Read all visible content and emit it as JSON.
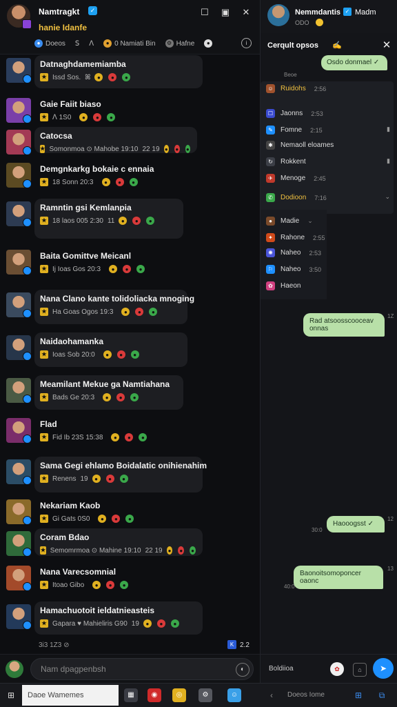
{
  "app": {
    "title": "Namtragkt",
    "subtitle": "hanie Idanfe",
    "verified_glyph": "✓"
  },
  "window_controls": [
    "☐",
    "▣",
    "✕"
  ],
  "tabs": [
    {
      "label": "Doeos",
      "icon": "globe-icon"
    },
    {
      "label": "ꓢ",
      "icon": "moon-icon"
    },
    {
      "label": "ꓥ",
      "icon": "headphones-icon"
    },
    {
      "label": "0 Namiati Bin",
      "icon": "coin-icon"
    },
    {
      "label": "Hafne",
      "icon": "settings-icon"
    },
    {
      "label": "",
      "icon": "ball-icon"
    }
  ],
  "rows": [
    {
      "name": "Datnaghdamemiamba",
      "meta": "Issd  Sos.",
      "extra": "ꕤ",
      "avatar_color": "#2a3d5c",
      "bubble": true
    },
    {
      "name": "Gaie Faiit biaso",
      "meta": "ꓥ  1S0",
      "extra": "",
      "avatar_color": "#7a3fa8",
      "bubble": false
    },
    {
      "name": "Catocsa",
      "meta": "Somonmoa  ⊙  Mahobe  19:10",
      "extra": "22  19",
      "avatar_color": "#a33a55",
      "bubble": true
    },
    {
      "name": "Demgnkarkg bokaie c ennaia",
      "meta": "18  Sonn  20:3",
      "extra": "",
      "avatar_color": "#5b4a22",
      "bubble": false
    },
    {
      "name": "Ramntin gsi Kemlanpia",
      "meta": "18  laos  005  2:30",
      "extra": "11",
      "avatar_color": "#2d3b52",
      "bubble": true
    },
    {
      "name": "Baita Gomittve Meicanl",
      "meta": "Ij  Ioas  Gos  20:3",
      "extra": "",
      "avatar_color": "#6a4e33",
      "bubble": false
    },
    {
      "name": "Nana Clano kante tolidoliacka mnoging",
      "meta": "Ha  Goas  Ogos  19:3",
      "extra": "",
      "avatar_color": "#3a4a5e",
      "bubble": true
    },
    {
      "name": "Naidaohamanka",
      "meta": "Ioas  Sob  20:0",
      "extra": "",
      "avatar_color": "#27364a",
      "bubble": true
    },
    {
      "name": "Meamilant Mekue ga Namtiahana",
      "meta": "Bads  Ge  20:3",
      "extra": "",
      "avatar_color": "#4a5a44",
      "bubble": true
    },
    {
      "name": "Flad",
      "meta": "Fid  Ib  23S  15:38",
      "extra": "",
      "avatar_color": "#7a2d6a",
      "bubble": false
    },
    {
      "name": "Sama Gegi ehlamo Boidalatic onihienahim",
      "meta": "Renens",
      "extra": "19",
      "avatar_color": "#2b4d66",
      "bubble": true
    },
    {
      "name": "Nekariam Kaob",
      "meta": "Gi  Gats  0S0",
      "extra": "",
      "avatar_color": "#8a6a2a",
      "bubble": false
    },
    {
      "name": "Coram Bdao",
      "meta": "Semomrmoa  ⊙  Mahine  19:10",
      "extra": "22  19",
      "avatar_color": "#2f6a3a",
      "bubble": true
    },
    {
      "name": "Nana Varecsomnial",
      "meta": "Itoao  Gibo",
      "extra": "",
      "avatar_color": "#a34a2a",
      "bubble": false
    },
    {
      "name": "Hamachuotoit ieldatnieasteis",
      "meta": "Gapara  ♥  Mahieliris  G90",
      "extra": "19",
      "avatar_color": "#233a5a",
      "bubble": true
    }
  ],
  "left_footer": {
    "meta": "3i3  1Z3  ⊘",
    "badge": "K",
    "count": "2.2"
  },
  "compose": {
    "placeholder": "Nam dpagpenbsh",
    "mic": "◐"
  },
  "right": {
    "title": "Nemmdantis",
    "title2": "Madm",
    "verified_glyph": "✓",
    "subtitle": "ODO",
    "panel_title": "Cerqult opsos",
    "pin_glyph": "✍",
    "close_glyph": "✕",
    "first_bubble": "Osdo donmael ✓",
    "first_time": "Beoe",
    "menu": [
      {
        "label": "Ruidohs",
        "num": "2:56",
        "icon_color": "#a0522d",
        "icon_glyph": "☺",
        "label_color": "#f0c040",
        "trail": ""
      },
      {
        "label": "Jaonns",
        "num": "2:53",
        "icon_color": "#3a4bd0",
        "icon_glyph": "☐",
        "label_color": "#dddddd",
        "trail": ""
      },
      {
        "label": "Fomne",
        "num": "2:15",
        "icon_color": "#1e90ff",
        "icon_glyph": "✎",
        "label_color": "#dddddd",
        "trail": "▮"
      },
      {
        "label": "Nemaoll eloames",
        "num": "",
        "icon_color": "#444444",
        "icon_glyph": "✱",
        "label_color": "#dddddd",
        "trail": ""
      },
      {
        "label": "Rokkent",
        "num": "",
        "icon_color": "#3c3f47",
        "icon_glyph": "↻",
        "label_color": "#dddddd",
        "trail": "▮"
      },
      {
        "label": "Menoge",
        "num": "2:45",
        "icon_color": "#c0392b",
        "icon_glyph": "✈",
        "label_color": "#dddddd",
        "trail": ""
      },
      {
        "label": "Dodioon",
        "num": "7:16",
        "icon_color": "#3aa84a",
        "icon_glyph": "✆",
        "label_color": "#f0c040",
        "trail": "⌄"
      },
      {
        "label": "Madie",
        "num": "⌄",
        "icon_color": "#7a4a2a",
        "icon_glyph": "●",
        "label_color": "#dddddd",
        "trail": ""
      },
      {
        "label": "Rahone",
        "num": "2:55",
        "icon_color": "#d04a1a",
        "icon_glyph": "✦",
        "label_color": "#dddddd",
        "trail": ""
      },
      {
        "label": "Naheo",
        "num": "2:53",
        "icon_color": "#4a55d8",
        "icon_glyph": "✺",
        "label_color": "#dddddd",
        "trail": ""
      },
      {
        "label": "Naheo",
        "num": "3:50",
        "icon_color": "#1e90ff",
        "icon_glyph": "⚐",
        "label_color": "#dddddd",
        "trail": ""
      },
      {
        "label": "Haeon",
        "num": "",
        "icon_color": "#d04080",
        "icon_glyph": "✿",
        "label_color": "#dddddd",
        "trail": ""
      }
    ],
    "bubble2": "Rad atsoosscooceav onnas",
    "bubble2_time": "1Z",
    "bubble3": "Haooogsst ✓",
    "bubble3_time_left": "30:0",
    "bubble3_time_right": "12",
    "bubble4": "Baonoitsomoponcer oaonc",
    "bubble4_time_left": "40:0",
    "bubble4_time_right": "13",
    "footer_label": "Boldiioa",
    "footer_emoji": "✿",
    "footer_attach": "⌂",
    "footer_send": "➤"
  },
  "taskbar": {
    "start": "⊞",
    "search_value": "Daoe Wamemes",
    "apps": [
      {
        "name": "files",
        "glyph": "▦",
        "color": "#3a3c44"
      },
      {
        "name": "red-app",
        "glyph": "◉",
        "color": "#d02a2a"
      },
      {
        "name": "yellow-app",
        "glyph": "◎",
        "color": "#e0b020"
      },
      {
        "name": "gear-app",
        "glyph": "⚙",
        "color": "#55575e"
      },
      {
        "name": "blue-app",
        "glyph": "☺",
        "color": "#3aa0e8"
      }
    ],
    "back": "‹",
    "label": "Doeos Iome",
    "icon_a": "⊞",
    "icon_b": "⧉"
  }
}
